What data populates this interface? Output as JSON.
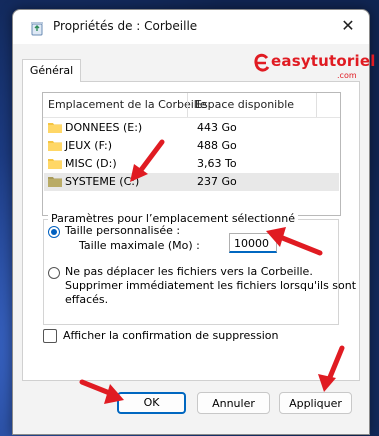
{
  "window": {
    "title": "Propriétés de : Corbeille",
    "close_glyph": "✕"
  },
  "tabs": [
    {
      "label": "Général"
    }
  ],
  "watermark": {
    "brand": "easytutoriel",
    "suffix": ".com"
  },
  "locations": {
    "columns": [
      "Emplacement de la Corbeille",
      "Espace disponible"
    ],
    "rows": [
      {
        "name": "DONNEES (E:)",
        "space": "443 Go",
        "icon": "folder-icon",
        "selected": false
      },
      {
        "name": "JEUX (F:)",
        "space": "488 Go",
        "icon": "folder-icon",
        "selected": false
      },
      {
        "name": "MISC (D:)",
        "space": "3,63 To",
        "icon": "folder-icon",
        "selected": false
      },
      {
        "name": "SYSTEME (C:)",
        "space": "237 Go",
        "icon": "folder-icon",
        "selected": true
      }
    ]
  },
  "settings": {
    "group_label": "Paramètres pour l’emplacement sélectionné",
    "custom_size_label": "Taille personnalisée :",
    "max_size_label": "Taille maximale (Mo) :",
    "max_size_value": "10000",
    "no_move_label_line1": "Ne pas déplacer les fichiers vers la Corbeille.",
    "no_move_label_line2": "Supprimer immédiatement les fichiers lorsqu'ils sont",
    "no_move_label_line3": "effacés.",
    "custom_selected": true
  },
  "confirm_delete": {
    "label": "Afficher la confirmation de suppression",
    "checked": false
  },
  "buttons": {
    "ok": "OK",
    "cancel": "Annuler",
    "apply": "Appliquer"
  },
  "colors": {
    "accent": "#0067c0",
    "arrow": "#e01b22",
    "folder": "#f5c542",
    "desktop": "#1f3f7a"
  }
}
